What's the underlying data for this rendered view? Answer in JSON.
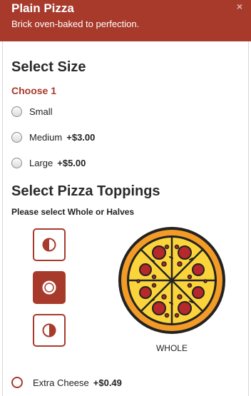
{
  "header": {
    "title": "Plain Pizza",
    "subtitle": "Brick oven-baked to perfection.",
    "close_label": "×"
  },
  "size": {
    "title": "Select Size",
    "choose_label": "Choose 1",
    "options": [
      {
        "label": "Small",
        "price": ""
      },
      {
        "label": "Medium",
        "price": "+$3.00"
      },
      {
        "label": "Large",
        "price": "+$5.00"
      }
    ]
  },
  "toppings": {
    "title": "Select Pizza Toppings",
    "instruction": "Please select Whole or Halves",
    "half_buttons": [
      {
        "name": "left-half",
        "active": false
      },
      {
        "name": "whole",
        "active": true
      },
      {
        "name": "right-half",
        "active": false
      }
    ],
    "pizza_label": "WHOLE",
    "items": [
      {
        "label": "Extra Cheese",
        "price": "+$0.49"
      }
    ]
  },
  "colors": {
    "accent": "#a83a2c",
    "crust": "#f29b27",
    "cheese": "#fbd43b",
    "pepperoni": "#b5282b"
  }
}
